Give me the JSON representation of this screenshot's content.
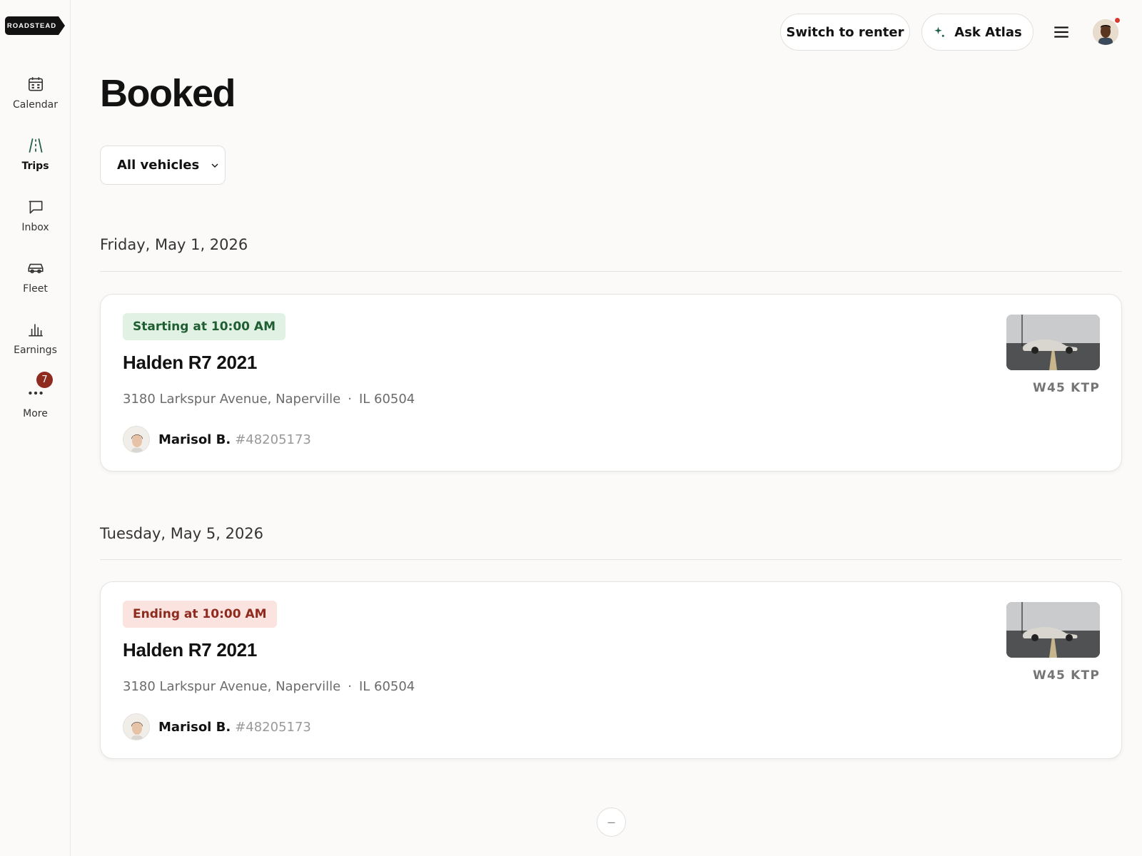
{
  "brand": {
    "logo_text": "ROADSTEAD"
  },
  "sidebar": {
    "items": [
      {
        "label": "Calendar",
        "icon": "calendar-icon"
      },
      {
        "label": "Trips",
        "icon": "trips-road-icon",
        "active": true
      },
      {
        "label": "Inbox",
        "icon": "inbox-chat-icon"
      },
      {
        "label": "Fleet",
        "icon": "car-icon"
      },
      {
        "label": "Earnings",
        "icon": "bar-chart-icon"
      },
      {
        "label": "More",
        "icon": "more-dots-icon",
        "badge": "7"
      }
    ]
  },
  "header": {
    "switch_label": "Switch to renter",
    "atlas_label": "Ask Atlas",
    "notification_dot_color": "#d7392a"
  },
  "page": {
    "title": "Booked",
    "filter_label": "All vehicles"
  },
  "groups": [
    {
      "date": "Friday, May 1, 2026",
      "trip": {
        "status": "Starting at 10:00 AM",
        "status_type": "start",
        "car": "Halden R7 2021",
        "street": "3180 Larkspur Avenue, Naperville",
        "separator": "·",
        "state_zip": "IL 60504",
        "guest_name": "Marisol B.",
        "guest_id": "#48205173",
        "plate": "W45 KTP"
      }
    },
    {
      "date": "Tuesday, May 5, 2026",
      "trip": {
        "status": "Ending at 10:00 AM",
        "status_type": "end",
        "car": "Halden R7 2021",
        "street": "3180 Larkspur Avenue, Naperville",
        "separator": "·",
        "state_zip": "IL 60504",
        "guest_name": "Marisol B.",
        "guest_id": "#48205173",
        "plate": "W45 KTP"
      }
    }
  ],
  "footer": {
    "load_more_symbol": "–"
  },
  "colors": {
    "start_pill_bg": "#e1f2e4",
    "start_pill_text": "#1f5e33",
    "end_pill_bg": "#fbe3df",
    "end_pill_text": "#8e2a1e",
    "badge": "#8e2a1e",
    "accent_green": "#1f5e4b"
  }
}
